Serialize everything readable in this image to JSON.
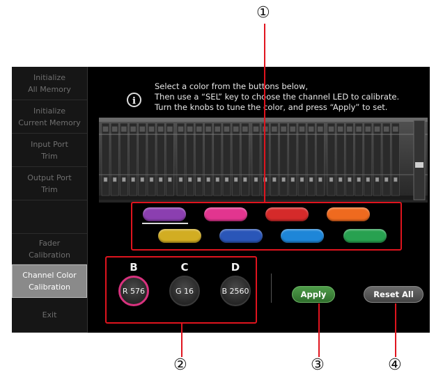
{
  "callouts": [
    "①",
    "②",
    "③",
    "④"
  ],
  "sidebar": {
    "items": [
      {
        "label": "Initialize\nAll Memory",
        "active": false
      },
      {
        "label": "Initialize\nCurrent Memory",
        "active": false
      },
      {
        "label": "Input Port\nTrim",
        "active": false
      },
      {
        "label": "Output Port\nTrim",
        "active": false
      },
      {
        "label": "",
        "active": false
      },
      {
        "label": "Fader\nCalibration",
        "active": false
      },
      {
        "label": "Channel Color\nCalibration",
        "active": true
      },
      {
        "label": "Exit",
        "active": false
      }
    ]
  },
  "info": {
    "icon": "info-icon",
    "lines": [
      "Select a color from the buttons below,",
      "Then use a “SEL” key to choose the channel LED to calibrate.",
      "Turn the knobs to tune the color, and press “Apply” to set."
    ]
  },
  "colors": [
    {
      "name": "purple",
      "hex": "#8b3fb0",
      "selected": true
    },
    {
      "name": "pink",
      "hex": "#e2358f",
      "selected": false
    },
    {
      "name": "red",
      "hex": "#d52a2a",
      "selected": false
    },
    {
      "name": "orange",
      "hex": "#ef6a1f",
      "selected": false
    },
    {
      "name": "yellow",
      "hex": "#d2ad22",
      "selected": false
    },
    {
      "name": "blue",
      "hex": "#2a56b8",
      "selected": false
    },
    {
      "name": "light-blue",
      "hex": "#1e86d8",
      "selected": false
    },
    {
      "name": "green",
      "hex": "#28a150",
      "selected": false
    }
  ],
  "knobs": [
    {
      "label": "B",
      "value": "R 576",
      "active": true
    },
    {
      "label": "C",
      "value": "G 16",
      "active": false
    },
    {
      "label": "D",
      "value": "B 2560",
      "active": false
    }
  ],
  "buttons": {
    "apply": "Apply",
    "reset_all": "Reset All"
  },
  "accent": "#e0141e"
}
